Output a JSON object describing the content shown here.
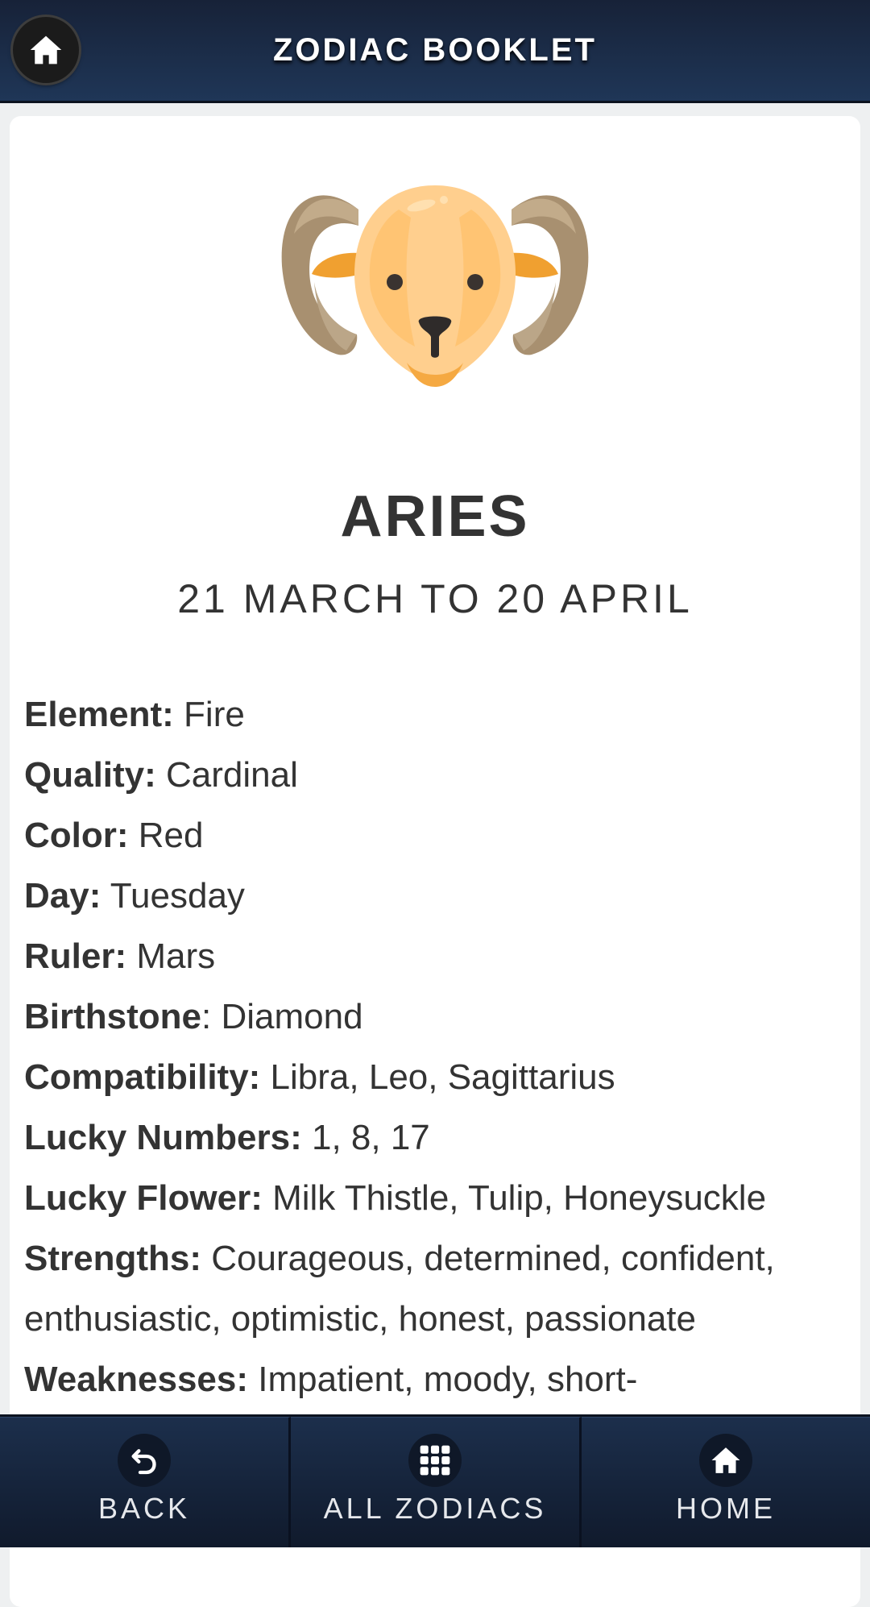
{
  "header": {
    "title": "ZODIAC BOOKLET",
    "home_icon": "home-icon"
  },
  "sign": {
    "name": "ARIES",
    "dates": "21 MARCH TO 20 APRIL",
    "image": "ram-head"
  },
  "details": [
    {
      "label": "Element:",
      "value": " Fire"
    },
    {
      "label": "Quality:",
      "value": " Cardinal"
    },
    {
      "label": "Color:",
      "value": " Red"
    },
    {
      "label": "Day:",
      "value": " Tuesday"
    },
    {
      "label": "Ruler:",
      "value": " Mars"
    },
    {
      "label": "Birthstone",
      "value": ": Diamond"
    },
    {
      "label": "Compatibility:",
      "value": " Libra, Leo, Sagittarius"
    },
    {
      "label": "Lucky Numbers:",
      "value": " 1, 8, 17"
    },
    {
      "label": "Lucky Flower:",
      "value": " Milk Thistle, Tulip, Honeysuckle"
    },
    {
      "label": "Strengths:",
      "value": " Courageous, determined, confident, enthusiastic, optimistic, honest, passionate"
    },
    {
      "label": "Weaknesses:",
      "value": " Impatient, moody, short-"
    }
  ],
  "footer": {
    "back": {
      "label": "BACK",
      "icon": "undo-icon"
    },
    "all": {
      "label": "ALL ZODIACS",
      "icon": "grid-icon"
    },
    "home": {
      "label": "HOME",
      "icon": "home-icon"
    }
  },
  "colors": {
    "header_bg": "#1f3657",
    "footer_bg": "#142239",
    "text": "#333333"
  }
}
